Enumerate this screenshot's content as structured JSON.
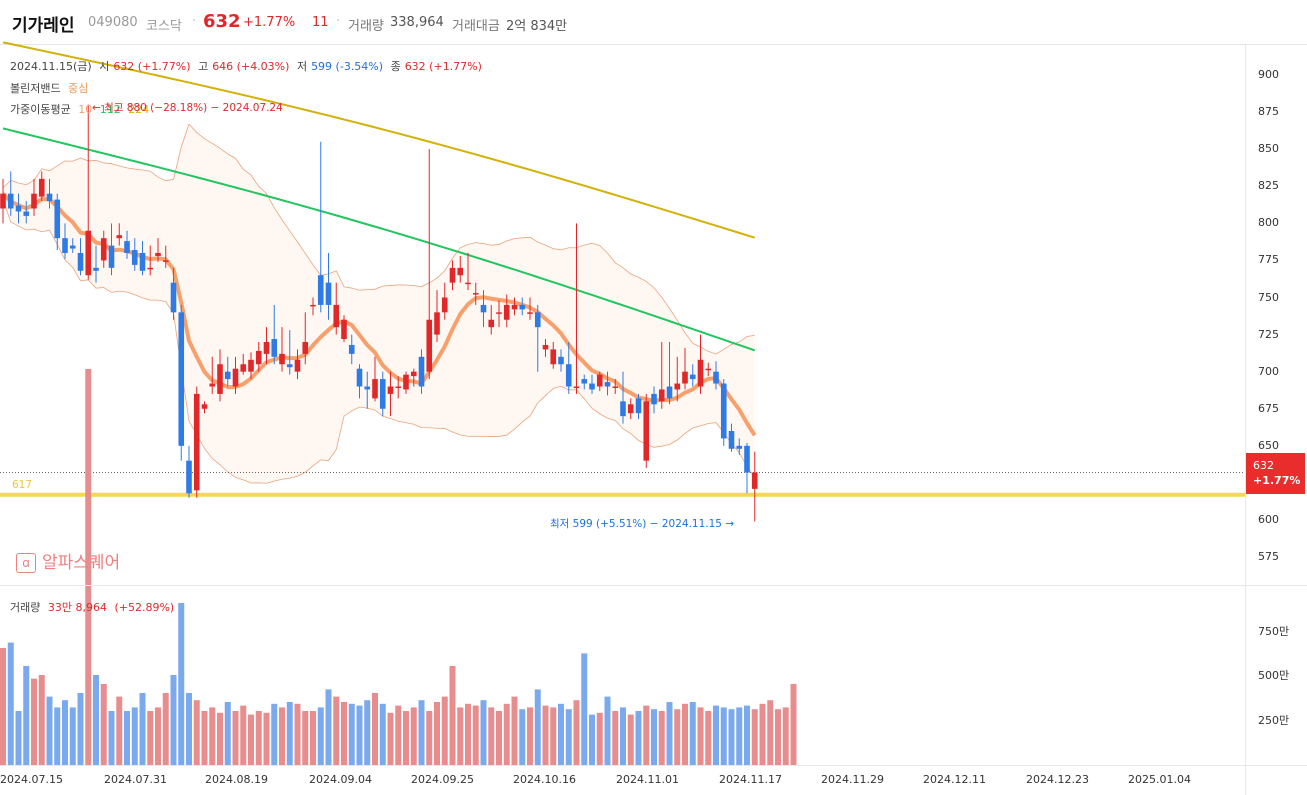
{
  "header": {
    "name": "기가레인",
    "code": "049080",
    "market": "코스닥",
    "price": "632",
    "change_pct": "+1.77%",
    "change": "11",
    "volume_label": "거래량",
    "volume": "338,964",
    "amount_label": "거래대금",
    "amount": "2억 834만",
    "separator": "·"
  },
  "info": {
    "date": "2024.11.15(금)",
    "open_label": "시",
    "open": "632 (+1.77%)",
    "high_label": "고",
    "high": "646 (+4.03%)",
    "low_label": "저",
    "low": "599 (-3.54%)",
    "close_label": "종",
    "close": "632 (+1.77%)",
    "bb_label": "볼린저밴드",
    "bb_mid": "중심",
    "ma_label": "가중이동평균",
    "ma1": "10",
    "ma2": "112",
    "ma3": "224",
    "high_annot": "최고 880 (−28.18%) − 2024.07.24"
  },
  "annotations": {
    "low_annot": "최저 599 (+5.51%) − 2024.11.15",
    "line617": "617",
    "price_tag": "632",
    "price_tag_pct": "+1.77%"
  },
  "volume_info": {
    "label": "거래량",
    "value": "33만 8,964",
    "pct": "(+52.89%)"
  },
  "watermark": "알파스퀘어",
  "watermark_icon": "ɑ",
  "colors": {
    "up": "#e0282b",
    "down": "#2f7be5",
    "ma10": "#f7a06c",
    "ma112": "#22c55e",
    "ma224": "#d4b106",
    "band": "#e9a47c",
    "line617": "#f6d94a"
  },
  "chart_data": {
    "type": "candlestick",
    "price_axis": {
      "ticks": [
        575,
        600,
        625,
        650,
        675,
        700,
        725,
        750,
        775,
        800,
        825,
        850,
        875,
        900
      ],
      "labels": [
        "575",
        "600",
        "",
        "650",
        "675",
        "700",
        "725",
        "750",
        "775",
        "800",
        "825",
        "850",
        "875",
        "900"
      ]
    },
    "volume_axis": {
      "ticks": [
        2500000,
        5000000,
        7500000
      ],
      "labels": [
        "250만",
        "500만",
        "750만"
      ]
    },
    "x_labels": [
      "2024.07.15",
      "2024.07.31",
      "2024.08.19",
      "2024.09.04",
      "2024.09.25",
      "2024.10.16",
      "2024.11.01",
      "2024.11.17",
      "2024.11.29",
      "2024.12.11",
      "2024.12.23",
      "2025.01.04"
    ],
    "candles": [
      [
        810,
        820,
        800,
        830
      ],
      [
        820,
        810,
        805,
        835
      ],
      [
        812,
        808,
        800,
        820
      ],
      [
        808,
        805,
        800,
        815
      ],
      [
        810,
        820,
        805,
        830
      ],
      [
        818,
        830,
        815,
        835
      ],
      [
        820,
        815,
        810,
        830
      ],
      [
        816,
        790,
        782,
        820
      ],
      [
        790,
        780,
        776,
        800
      ],
      [
        785,
        783,
        780,
        790
      ],
      [
        780,
        768,
        765,
        790
      ],
      [
        765,
        795,
        762,
        880
      ],
      [
        770,
        768,
        760,
        785
      ],
      [
        775,
        790,
        770,
        795
      ],
      [
        785,
        770,
        765,
        800
      ],
      [
        790,
        792,
        785,
        800
      ],
      [
        788,
        780,
        776,
        795
      ],
      [
        782,
        772,
        768,
        790
      ],
      [
        780,
        768,
        765,
        788
      ],
      [
        770,
        770,
        765,
        785
      ],
      [
        778,
        780,
        774,
        790
      ],
      [
        775,
        775,
        770,
        785
      ],
      [
        760,
        740,
        735,
        770
      ],
      [
        740,
        650,
        640,
        745
      ],
      [
        640,
        618,
        615,
        650
      ],
      [
        620,
        685,
        615,
        690
      ],
      [
        675,
        678,
        672,
        680
      ],
      [
        690,
        692,
        685,
        710
      ],
      [
        685,
        705,
        680,
        715
      ],
      [
        700,
        695,
        690,
        710
      ],
      [
        690,
        702,
        685,
        710
      ],
      [
        700,
        705,
        698,
        712
      ],
      [
        700,
        708,
        695,
        713
      ],
      [
        705,
        714,
        700,
        720
      ],
      [
        712,
        720,
        705,
        730
      ],
      [
        722,
        710,
        705,
        745
      ],
      [
        705,
        712,
        700,
        730
      ],
      [
        705,
        703,
        698,
        728
      ],
      [
        700,
        708,
        695,
        715
      ],
      [
        712,
        720,
        705,
        740
      ],
      [
        745,
        745,
        738,
        750
      ],
      [
        765,
        745,
        740,
        855
      ],
      [
        760,
        745,
        735,
        780
      ],
      [
        730,
        745,
        725,
        760
      ],
      [
        722,
        735,
        720,
        738
      ],
      [
        718,
        712,
        705,
        725
      ],
      [
        702,
        690,
        682,
        705
      ],
      [
        690,
        688,
        675,
        700
      ],
      [
        682,
        695,
        680,
        710
      ],
      [
        695,
        675,
        670,
        700
      ],
      [
        685,
        690,
        670,
        700
      ],
      [
        690,
        690,
        682,
        697
      ],
      [
        688,
        698,
        685,
        700
      ],
      [
        697,
        700,
        690,
        702
      ],
      [
        710,
        690,
        685,
        715
      ],
      [
        700,
        735,
        695,
        850
      ],
      [
        725,
        740,
        720,
        755
      ],
      [
        740,
        750,
        735,
        760
      ],
      [
        760,
        770,
        755,
        775
      ],
      [
        765,
        770,
        760,
        778
      ],
      [
        760,
        760,
        755,
        780
      ],
      [
        752,
        753,
        745,
        760
      ],
      [
        745,
        740,
        730,
        755
      ],
      [
        730,
        735,
        725,
        745
      ],
      [
        740,
        740,
        730,
        748
      ],
      [
        735,
        745,
        730,
        752
      ],
      [
        742,
        745,
        738,
        750
      ],
      [
        745,
        742,
        738,
        750
      ],
      [
        740,
        740,
        735,
        750
      ],
      [
        740,
        730,
        700,
        745
      ],
      [
        715,
        718,
        710,
        722
      ],
      [
        705,
        715,
        702,
        720
      ],
      [
        710,
        705,
        700,
        715
      ],
      [
        705,
        690,
        685,
        720
      ],
      [
        690,
        690,
        685,
        800
      ],
      [
        695,
        692,
        688,
        698
      ],
      [
        692,
        688,
        685,
        698
      ],
      [
        690,
        698,
        687,
        700
      ],
      [
        693,
        690,
        684,
        700
      ],
      [
        690,
        690,
        685,
        695
      ],
      [
        680,
        670,
        665,
        700
      ],
      [
        672,
        678,
        668,
        682
      ],
      [
        682,
        672,
        668,
        685
      ],
      [
        640,
        680,
        635,
        685
      ],
      [
        685,
        678,
        672,
        690
      ],
      [
        680,
        688,
        675,
        720
      ],
      [
        690,
        682,
        678,
        720
      ],
      [
        688,
        692,
        680,
        710
      ],
      [
        692,
        700,
        688,
        716
      ],
      [
        698,
        695,
        690,
        705
      ],
      [
        690,
        708,
        685,
        725
      ],
      [
        702,
        702,
        697,
        706
      ],
      [
        700,
        692,
        688,
        707
      ],
      [
        692,
        655,
        650,
        695
      ],
      [
        660,
        648,
        646,
        665
      ],
      [
        650,
        648,
        644,
        655
      ],
      [
        650,
        632,
        618,
        652
      ],
      [
        621,
        632,
        599,
        646
      ]
    ],
    "volumes": [
      6.5,
      6.8,
      3,
      5.5,
      4.8,
      5,
      3.8,
      3.2,
      3.6,
      3.2,
      4,
      22,
      5,
      4.5,
      3,
      3.8,
      3,
      3.2,
      4,
      3,
      3.2,
      4,
      5,
      9,
      4,
      3.6,
      3,
      3.2,
      2.9,
      3.5,
      3,
      3.3,
      2.8,
      3,
      2.9,
      3.4,
      3.2,
      3.5,
      3.4,
      3,
      3,
      3.2,
      4.2,
      3.8,
      3.5,
      3.4,
      3.3,
      3.6,
      4,
      3.4,
      2.9,
      3.3,
      3,
      3.2,
      3.6,
      3,
      3.5,
      3.8,
      5.5,
      3.2,
      3.4,
      3.3,
      3.6,
      3.2,
      3,
      3.4,
      3.8,
      3.1,
      3.2,
      4.2,
      3.3,
      3.2,
      3.4,
      3.1,
      3.6,
      6.2,
      2.8,
      2.9,
      3.8,
      3,
      3.2,
      2.8,
      3,
      3.3,
      3.1,
      3,
      3.5,
      3.1,
      3.4,
      3.5,
      3.2,
      3,
      3.3,
      3.2,
      3.1,
      3.2,
      3.3,
      3.1,
      3.4,
      3.6,
      3.1,
      3.2,
      4.5
    ]
  }
}
